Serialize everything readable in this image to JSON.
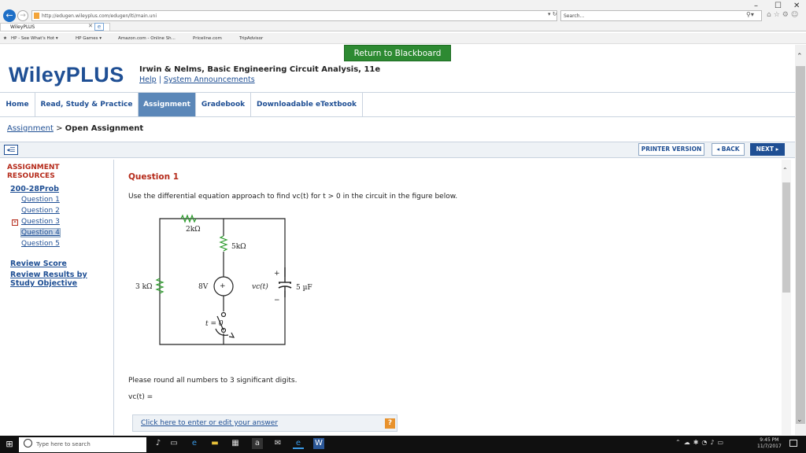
{
  "browser": {
    "window_controls": [
      "–",
      "☐",
      "✕"
    ],
    "url": "http://edugen.wileyplus.com/edugen/lti/main.uni",
    "search_placeholder": "Search...",
    "tab_title": "WileyPLUS",
    "favorites": [
      "HP - See What's Hot ▾",
      "HP Games ▾",
      "Amazon.com - Online Sh...",
      "Priceline.com",
      "TripAdvisor"
    ]
  },
  "header": {
    "return_button": "Return to Blackboard",
    "logo": "WileyPLUS",
    "book_title": "Irwin & Nelms, Basic Engineering Circuit Analysis, 11e",
    "help": "Help",
    "separator": "|",
    "announcements": "System Announcements"
  },
  "nav": {
    "tabs": [
      {
        "label": "Home"
      },
      {
        "label": "Read, Study & Practice"
      },
      {
        "label": "Assignment"
      },
      {
        "label": "Gradebook"
      },
      {
        "label": "Downloadable eTextbook"
      }
    ],
    "active_tab": "Assignment"
  },
  "breadcrumb": {
    "link": "Assignment",
    "separator": ">",
    "current": "Open Assignment"
  },
  "actions": {
    "printer": "PRINTER VERSION",
    "back": "◂ BACK",
    "next": "NEXT ▸"
  },
  "sidebar": {
    "heading_line1": "ASSIGNMENT",
    "heading_line2": "RESOURCES",
    "problem": "200-28Prob",
    "questions": [
      "Question 1",
      "Question 2",
      "Question 3",
      "Question 4",
      "Question 5"
    ],
    "selected_question": "Question 4",
    "review_score": "Review Score",
    "review_results_line1": "Review Results by",
    "review_results_line2": "Study Objective"
  },
  "question": {
    "title": "Question 1",
    "text": "Use the differential equation approach to find vc(t) for t > 0 in the circuit in the figure below.",
    "round_note": "Please round all numbers to 3 significant digits.",
    "equation": "vc(t) =",
    "answer_link": "Click here to enter or edit your answer",
    "help_icon": "?"
  },
  "circuit": {
    "r_top": "2kΩ",
    "r_mid": "5kΩ",
    "r_left": "3 kΩ",
    "source": "8V",
    "source_sign": "+",
    "cap_label": "vc(t)",
    "cap_value": "5 µF",
    "plus": "+",
    "minus": "−",
    "switch_label": "t = 0"
  },
  "taskbar": {
    "search_placeholder": "Type here to search",
    "time": "9:45 PM",
    "date": "11/7/2017"
  }
}
